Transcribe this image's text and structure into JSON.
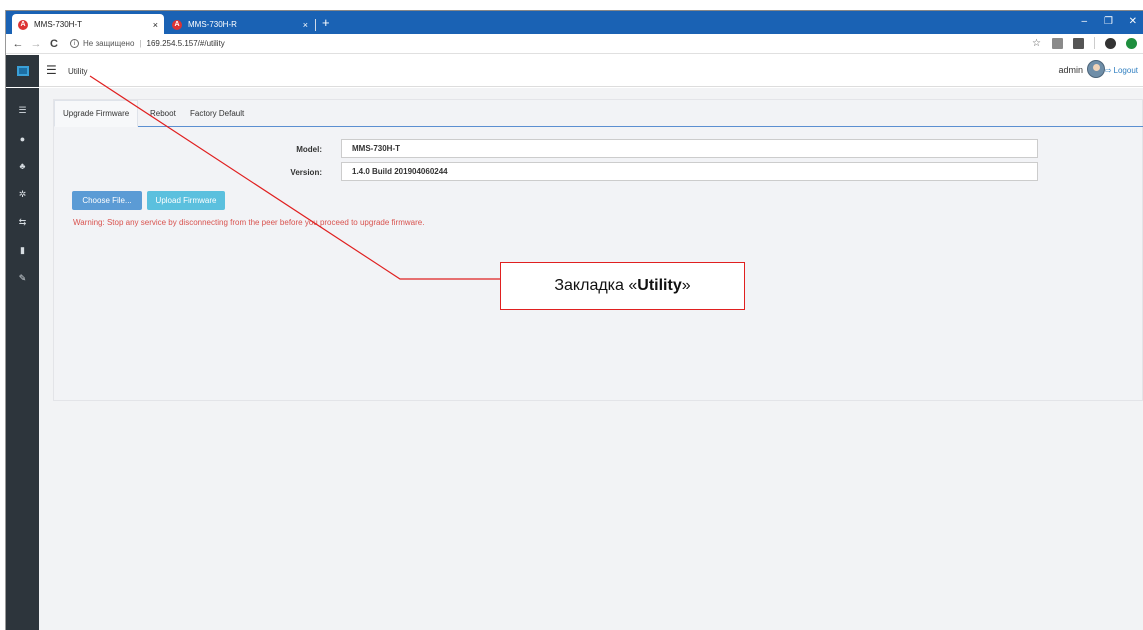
{
  "browser": {
    "tabs": [
      {
        "label": "MMS-730H-T",
        "close": "×"
      },
      {
        "label": "MMS-730H-R",
        "close": "×"
      }
    ],
    "new_tab": "+",
    "window_controls": {
      "minimize": "–",
      "restore": "❐",
      "close": "✕"
    },
    "nav": {
      "back": "←",
      "forward": "→",
      "reload": "C"
    },
    "security_text": "Не защищено",
    "url": "169.254.5.157/#/utility",
    "toolbar_icons": [
      "star-icon",
      "pdf-extension-icon",
      "extension-icon",
      "profile-icon",
      "extension-green-icon"
    ]
  },
  "app": {
    "breadcrumb": "Utility",
    "user_name": "admin",
    "logout_label": "Logout",
    "sidebar_icons": [
      "list-icon",
      "user-icon",
      "sitemap-icon",
      "gear-icon",
      "usb-icon",
      "database-icon",
      "wrench-icon"
    ]
  },
  "utility": {
    "tabs": [
      "Upgrade Firmware",
      "Reboot",
      "Factory Default"
    ],
    "active_tab": "Upgrade Firmware",
    "model_label": "Model:",
    "model_value": "MMS-730H-T",
    "version_label": "Version:",
    "version_value": "1.4.0 Build 201904060244",
    "choose_file_label": "Choose File...",
    "upload_label": "Upload Firmware",
    "warning": "Warning: Stop any service by disconnecting from the peer before you proceed to upgrade firmware."
  },
  "annotation": {
    "prefix": "Закладка «",
    "bold": "Utility",
    "suffix": "»",
    "color": "#e02020"
  }
}
